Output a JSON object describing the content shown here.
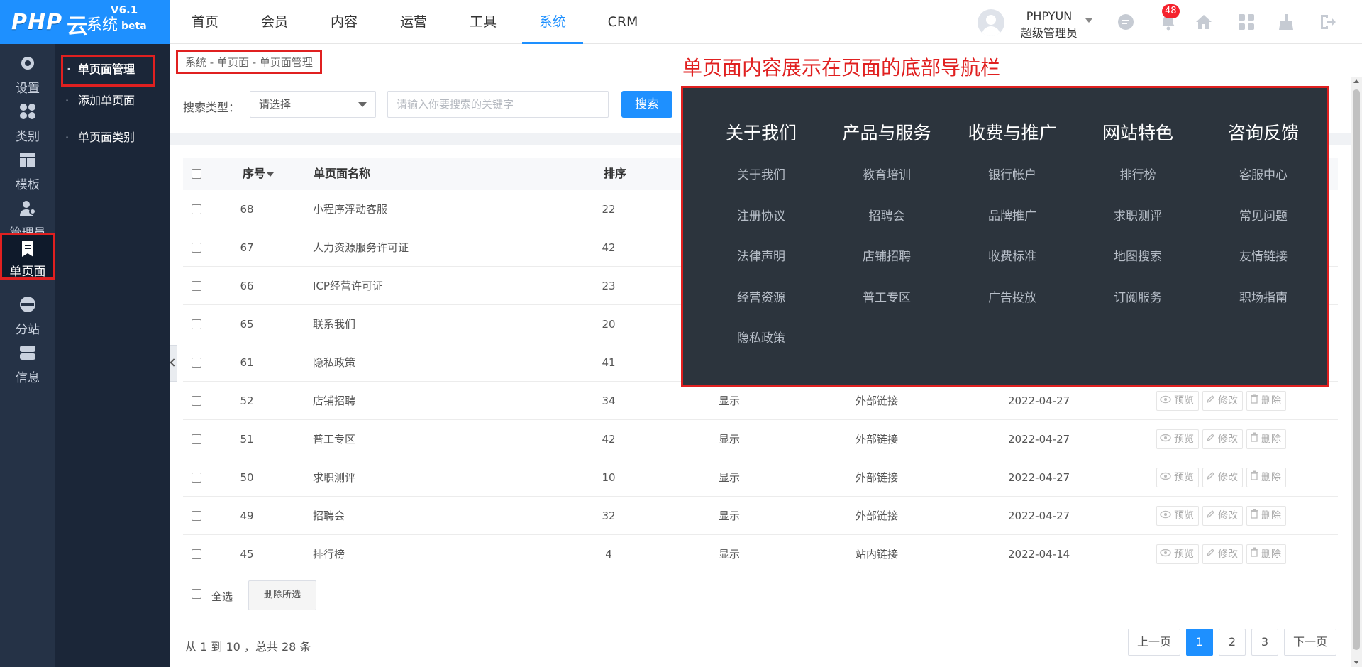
{
  "logo": {
    "php": "PHP",
    "cloud": "云",
    "system": "系统",
    "version": "V6.1",
    "beta": "beta"
  },
  "topnav": [
    "首页",
    "会员",
    "内容",
    "运营",
    "工具",
    "系统",
    "CRM"
  ],
  "topnav_active": "系统",
  "user": {
    "name": "PHPYUN",
    "role": "超级管理员",
    "notification_count": "48"
  },
  "header_icons": [
    "chat-icon",
    "bell-icon",
    "home-icon",
    "apps-icon",
    "broom-icon",
    "logout-icon"
  ],
  "sidebar": [
    {
      "label": "设置",
      "icon": "gear-icon"
    },
    {
      "label": "类别",
      "icon": "category-icon"
    },
    {
      "label": "模板",
      "icon": "template-icon"
    },
    {
      "label": "管理员",
      "icon": "admin-icon"
    },
    {
      "label": "单页面",
      "icon": "page-icon"
    },
    {
      "label": "分站",
      "icon": "www-icon"
    },
    {
      "label": "信息",
      "icon": "server-icon"
    }
  ],
  "sidebar_active": "单页面",
  "submenu": [
    "单页面管理",
    "添加单页面",
    "单页面类别"
  ],
  "breadcrumb": "系统 - 单页面 - 单页面管理",
  "search": {
    "label": "搜索类型：",
    "select_value": "请选择",
    "placeholder": "请输入你要搜索的关键字",
    "button": "搜索"
  },
  "table": {
    "headers": {
      "id": "序号",
      "name": "单页面名称",
      "sort": "排序"
    },
    "rows": [
      {
        "id": "68",
        "name": "小程序浮动客服",
        "sort": "22",
        "status": "",
        "link": "",
        "date": ""
      },
      {
        "id": "67",
        "name": "人力资源服务许可证",
        "sort": "42",
        "status": "",
        "link": "",
        "date": ""
      },
      {
        "id": "66",
        "name": "ICP经营许可证",
        "sort": "23",
        "status": "",
        "link": "",
        "date": ""
      },
      {
        "id": "65",
        "name": "联系我们",
        "sort": "20",
        "status": "",
        "link": "",
        "date": ""
      },
      {
        "id": "61",
        "name": "隐私政策",
        "sort": "41",
        "status": "",
        "link": "",
        "date": ""
      },
      {
        "id": "52",
        "name": "店铺招聘",
        "sort": "34",
        "status": "显示",
        "link": "外部链接",
        "date": "2022-04-27"
      },
      {
        "id": "51",
        "name": "普工专区",
        "sort": "42",
        "status": "显示",
        "link": "外部链接",
        "date": "2022-04-27"
      },
      {
        "id": "50",
        "name": "求职测评",
        "sort": "10",
        "status": "显示",
        "link": "外部链接",
        "date": "2022-04-27"
      },
      {
        "id": "49",
        "name": "招聘会",
        "sort": "32",
        "status": "显示",
        "link": "外部链接",
        "date": "2022-04-27"
      },
      {
        "id": "45",
        "name": "排行榜",
        "sort": "4",
        "status": "显示",
        "link": "站内链接",
        "date": "2022-04-14"
      }
    ],
    "actions": {
      "preview": "预览",
      "edit": "修改",
      "delete": "删除"
    }
  },
  "bulk": {
    "select_all": "全选",
    "delete_selected": "删除所选"
  },
  "pagination": {
    "summary": "从 1 到 10 ，总共 28 条",
    "prev": "上一页",
    "pages": [
      "1",
      "2",
      "3"
    ],
    "current": "1",
    "next": "下一页"
  },
  "annotation": {
    "title": "单页面内容展示在页面的底部导航栏",
    "columns": [
      {
        "heading": "关于我们",
        "links": [
          "关于我们",
          "注册协议",
          "法律声明",
          "经营资源",
          "隐私政策"
        ]
      },
      {
        "heading": "产品与服务",
        "links": [
          "教育培训",
          "招聘会",
          "店铺招聘",
          "普工专区"
        ]
      },
      {
        "heading": "收费与推广",
        "links": [
          "银行帐户",
          "品牌推广",
          "收费标准",
          "广告投放"
        ]
      },
      {
        "heading": "网站特色",
        "links": [
          "排行榜",
          "求职测评",
          "地图搜索",
          "订阅服务"
        ]
      },
      {
        "heading": "咨询反馈",
        "links": [
          "客服中心",
          "常见问题",
          "友情链接",
          "职场指南"
        ]
      }
    ]
  },
  "colors": {
    "brand": "#1e90ff",
    "sidebar": "#253246",
    "highlight": "#e02020",
    "panel": "#2c343d"
  }
}
